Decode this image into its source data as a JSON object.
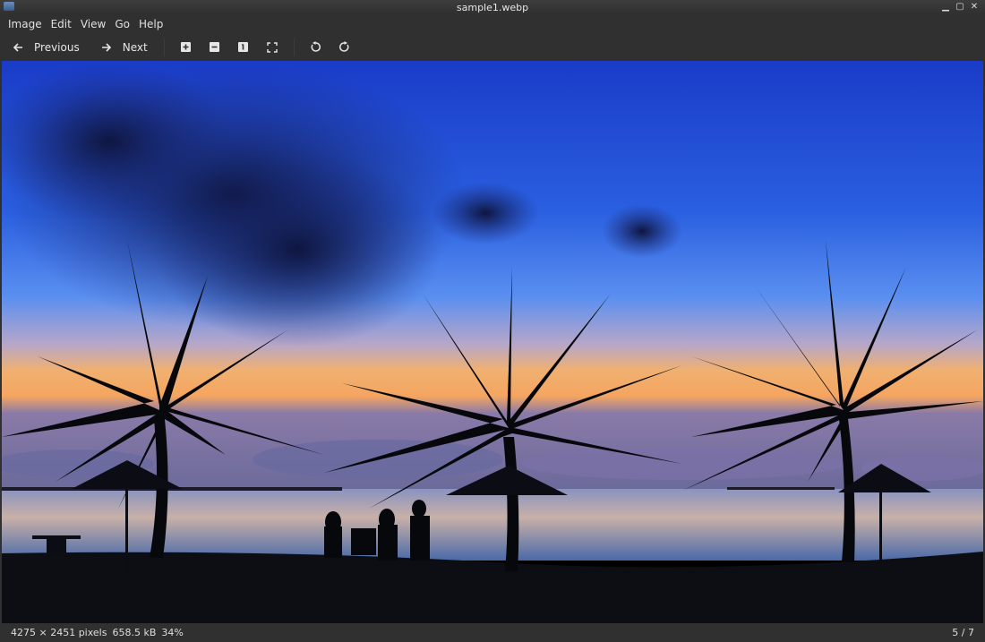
{
  "window": {
    "title": "sample1.webp",
    "controls": [
      "minimize-icon",
      "maximize-icon",
      "close-icon"
    ]
  },
  "menu": {
    "items": [
      "Image",
      "Edit",
      "View",
      "Go",
      "Help"
    ]
  },
  "toolbar": {
    "previous_label": "Previous",
    "next_label": "Next",
    "icons": [
      "arrow-left-icon",
      "arrow-right-icon",
      "zoom-in-icon",
      "zoom-out-icon",
      "actual-size-icon",
      "fit-window-icon",
      "rotate-left-icon",
      "rotate-right-icon"
    ]
  },
  "image": {
    "description_icon": "photo-beach-sunset-palms"
  },
  "status": {
    "dimensions": "4275 × 2451 pixels",
    "filesize": "658.5 kB",
    "zoom": "34%",
    "page": "5 / 7"
  },
  "colors": {
    "background": "#303030",
    "text": "#e0e0e0",
    "sky_top": "#1f3fbf",
    "horizon": "#f0a060"
  }
}
